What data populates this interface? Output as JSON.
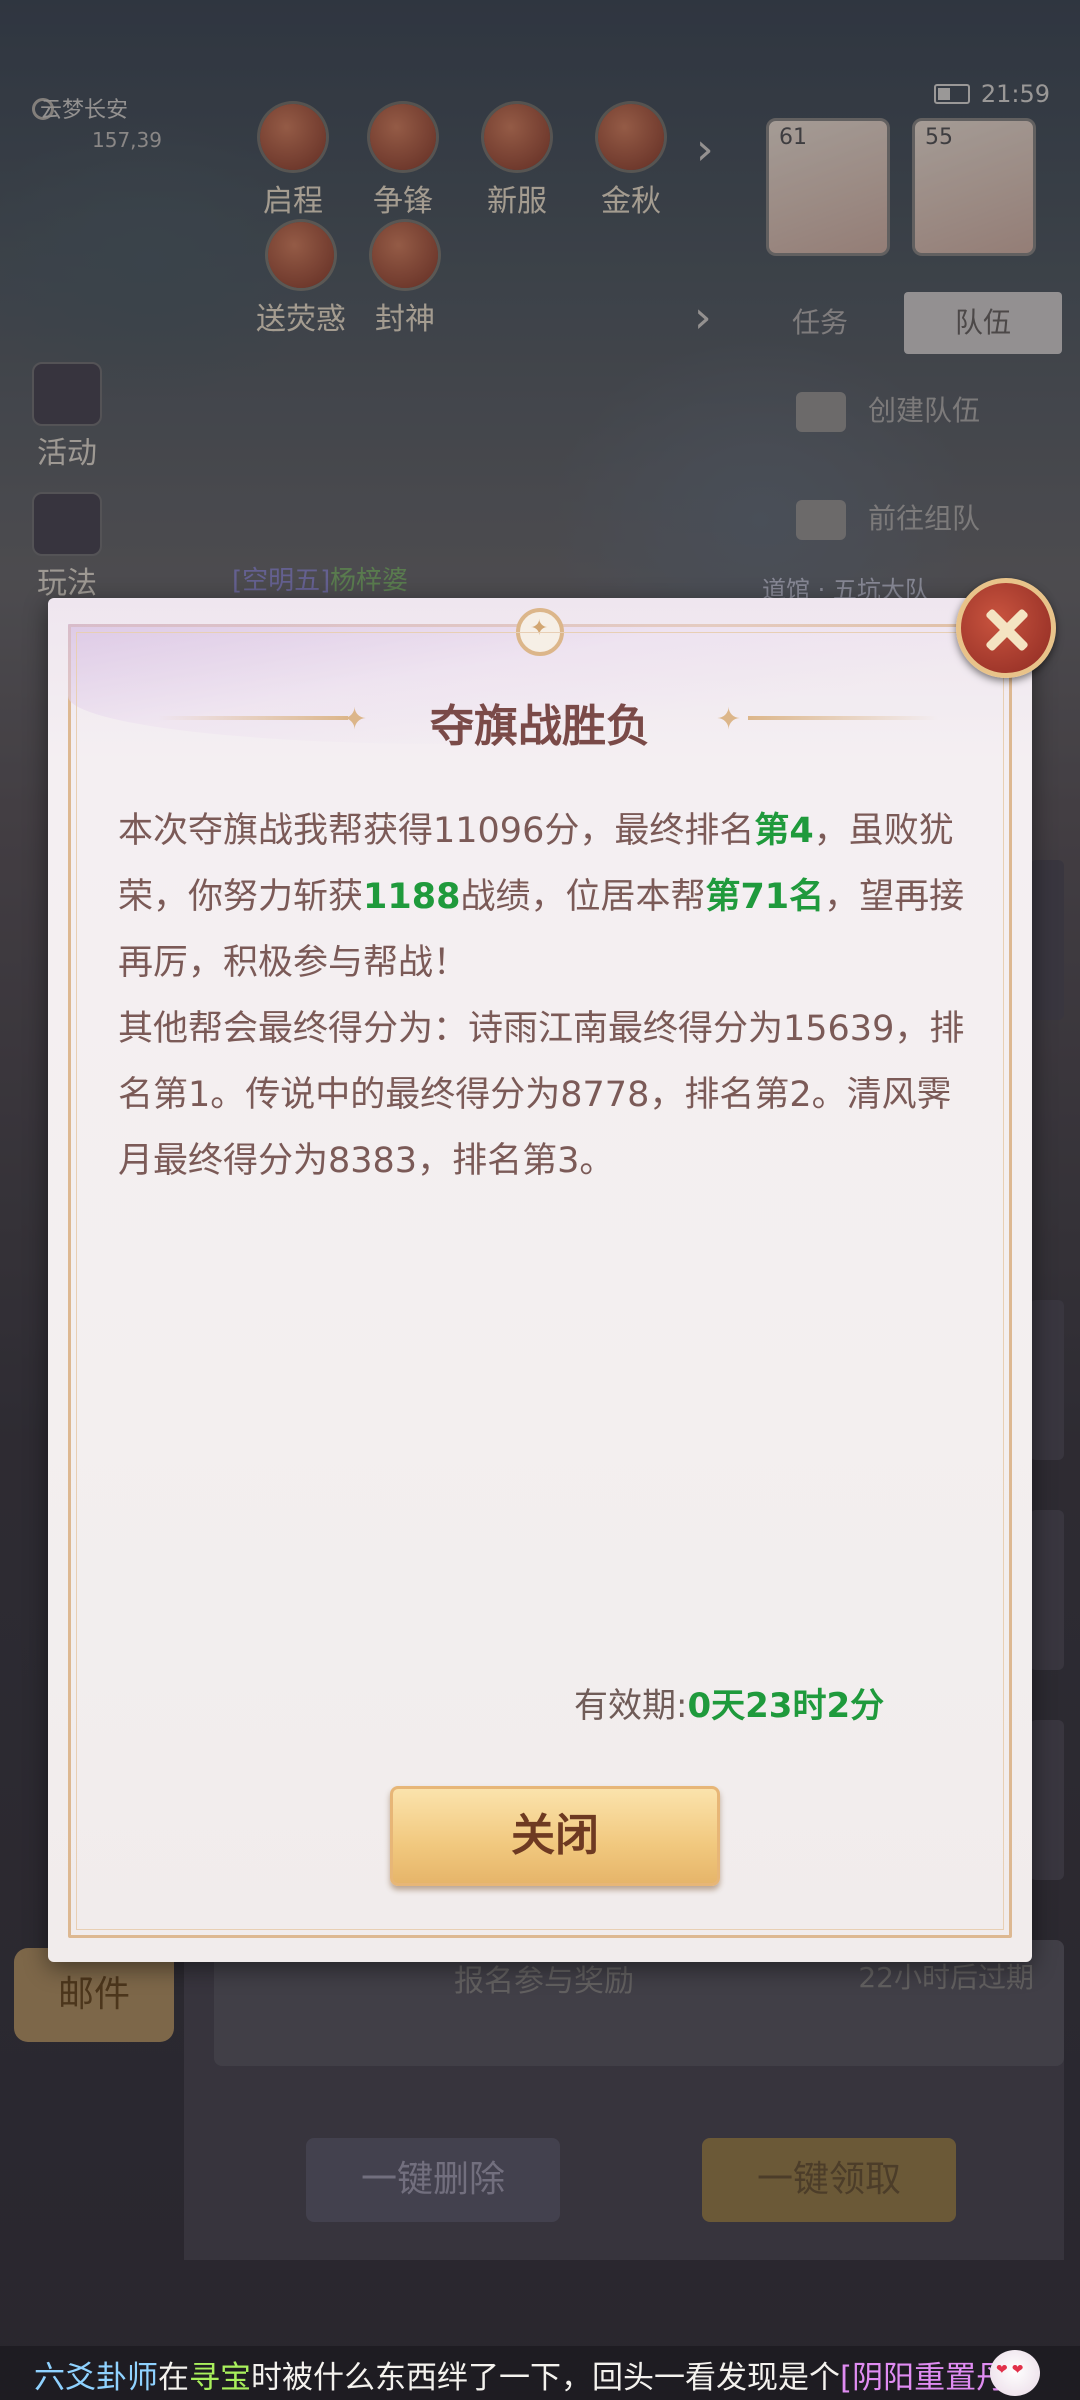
{
  "status": {
    "clock": "21:59"
  },
  "location": {
    "city": "云梦长安",
    "coords": "157,39"
  },
  "top_buttons": {
    "b1": "启程",
    "b2": "争锋",
    "b3": "新服",
    "b4": "金秋",
    "b5": "送荧惑",
    "b6": "封神"
  },
  "avatars": {
    "a1_level": "61",
    "a2_level": "55"
  },
  "tabs": {
    "task": "任务",
    "team": "队伍"
  },
  "team_panel": {
    "create": "创建队伍",
    "goto": "前往组队"
  },
  "side_menu": {
    "activity": "活动",
    "gameplay": "玩法"
  },
  "scene_labels": {
    "chat_tag": "[空明五]",
    "chat_name": "杨梓婆",
    "npc": "道馆 · 五坑大队"
  },
  "mail": {
    "tab": "邮件",
    "row_title": "报名参与奖励",
    "row_expire": "22小时后过期",
    "delete_all": "一键删除",
    "claim_all": "一键领取"
  },
  "dialog": {
    "title": "夺旗战胜负",
    "line1_a": "本次夺旗战我帮获得11096分，最终排名",
    "line1_rank": "第4",
    "line1_b": "，虽败犹荣，你努力斩获",
    "line1_merit": "1188",
    "line1_c": "战绩，位居本帮",
    "line1_pos": "第71名",
    "line1_d": "，望再接再厉，积极参与帮战！",
    "line2": "其他帮会最终得分为：诗雨江南最终得分为15639，排名第1。传说中的最终得分为8778，排名第2。清风霁月最终得分为8383，排名第3。",
    "validity_label": "有效期:",
    "validity_value": "0天23时2分",
    "close_button": "关闭"
  },
  "broadcast": {
    "role": "六爻卦师",
    "part1": "在",
    "action": "寻宝",
    "part2": "时被什么东西绊了一下，回头一看发现是个",
    "item": "[阴阳重置丹]"
  },
  "colors": {
    "highlight_green": "#1f9a3c",
    "title_brown": "#7a4a48",
    "gold_button": "#f1c87e"
  },
  "icons": [
    "settings-icon",
    "battery-icon",
    "chevron-right-icon",
    "flag-icon",
    "add-member-icon",
    "close-x-icon",
    "emoji-icon",
    "crest-icon"
  ]
}
